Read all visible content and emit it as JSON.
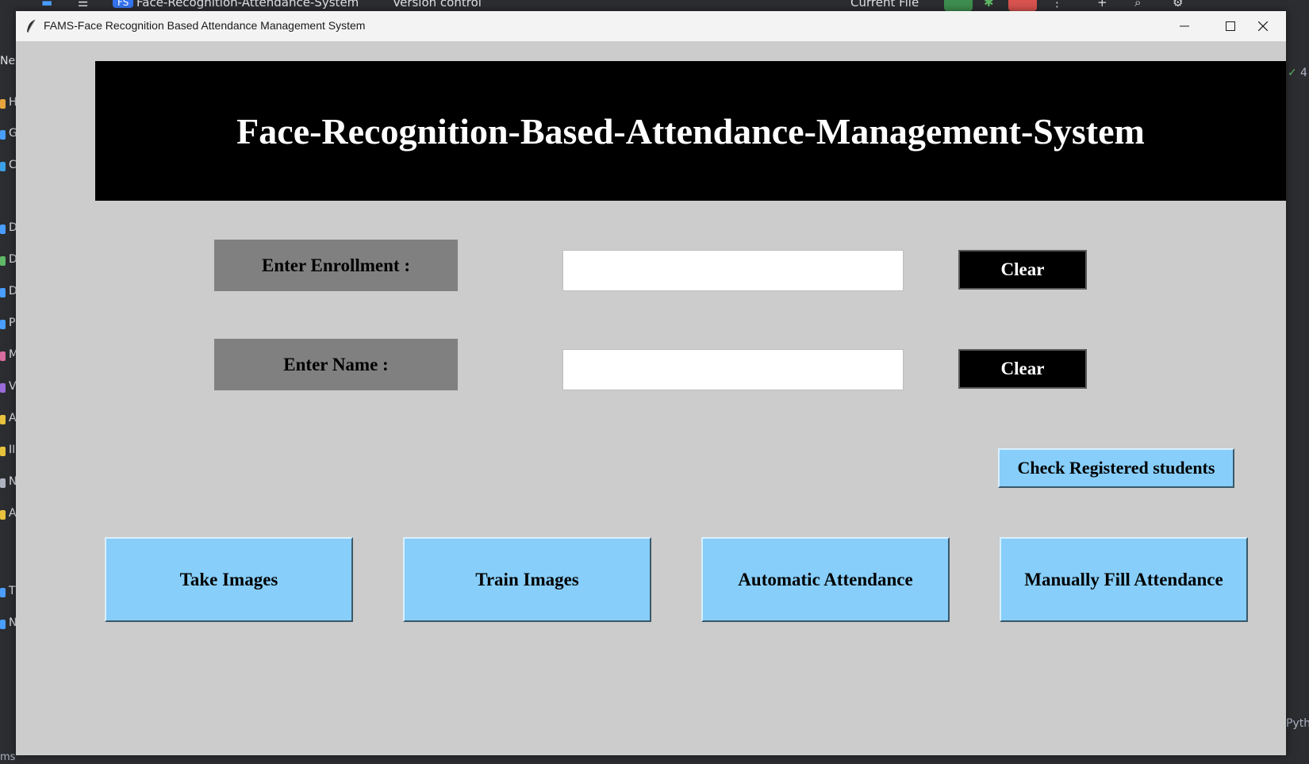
{
  "ide": {
    "project_title": "Face-Recognition-Attendance-System",
    "project_badge": "FS",
    "vcs_label": "Version control",
    "run_config": "Current File",
    "left_initials": [
      "H",
      "G",
      "C",
      "D",
      "D",
      "D",
      "P",
      "M",
      "V",
      "A",
      "II",
      "N",
      "A",
      "T",
      "N"
    ],
    "left_top_text": "New",
    "right_status": "4",
    "right_bottom_text": "Pyth",
    "bottom_text": "ms"
  },
  "window": {
    "title": "FAMS-Face Recognition Based Attendance Management System"
  },
  "banner": {
    "text": "Face-Recognition-Based-Attendance-Management-System"
  },
  "form": {
    "enrollment_label": "Enter Enrollment :",
    "enrollment_value": "",
    "name_label": "Enter Name :",
    "name_value": "",
    "clear_label_1": "Clear",
    "clear_label_2": "Clear"
  },
  "buttons": {
    "check_registered": "Check Registered students",
    "take_images": "Take Images",
    "train_images": "Train Images",
    "automatic_attendance": "Automatic Attendance",
    "manual_attendance": "Manually Fill Attendance"
  },
  "colors": {
    "window_bg": "#cccccc",
    "banner_bg": "#000000",
    "label_bg": "#808080",
    "button_blue": "#87cefa",
    "ide_bg": "#2b2d30"
  }
}
